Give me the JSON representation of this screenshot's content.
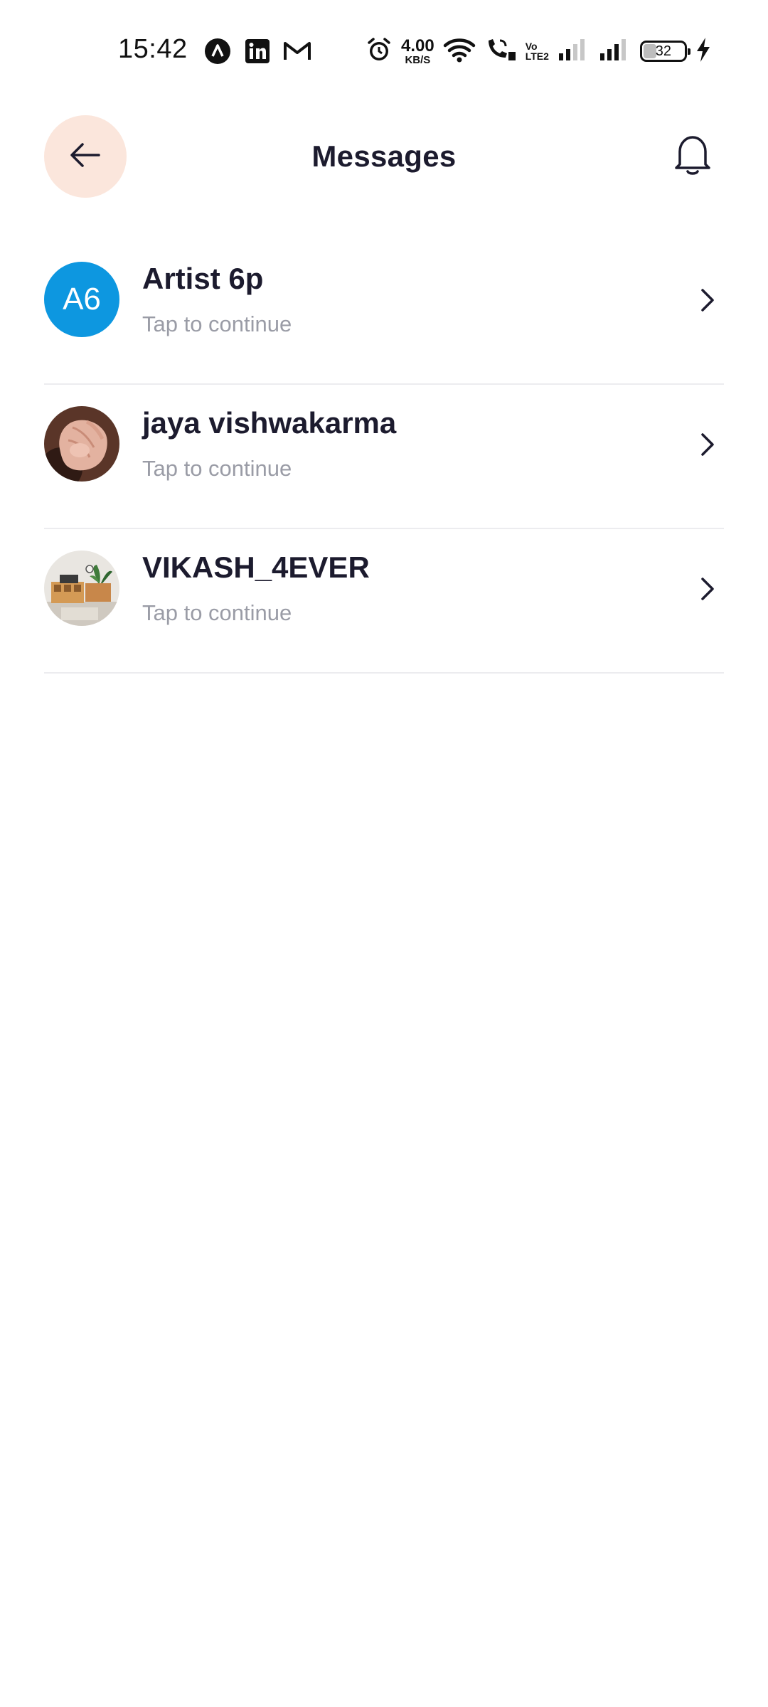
{
  "status_bar": {
    "time": "15:42",
    "notification_icons": [
      "app-a-icon",
      "linkedin-icon",
      "gmail-icon"
    ],
    "speed_value": "4.00",
    "speed_unit": "KB/S",
    "volte_top": "Vo",
    "volte_bottom": "LTE2",
    "battery_level": "32",
    "charging": true
  },
  "header": {
    "title": "Messages",
    "back_icon": "arrow-left-icon",
    "notification_icon": "bell-icon",
    "back_button_bg": "#fbe6dc"
  },
  "conversations": [
    {
      "name": "Artist 6p",
      "subtitle": "Tap to continue",
      "avatar_initials": "A6",
      "avatar_color": "#0d97e0"
    },
    {
      "name": "jaya vishwakarma",
      "subtitle": "Tap to continue",
      "avatar_initials": "",
      "avatar_type": "photo-hand"
    },
    {
      "name": "VIKASH_4EVER",
      "subtitle": "Tap to continue",
      "avatar_initials": "",
      "avatar_type": "photo-room"
    }
  ],
  "colors": {
    "title_text": "#1c1b2e",
    "subtitle_text": "#9a9ca6",
    "divider": "#ececef"
  }
}
